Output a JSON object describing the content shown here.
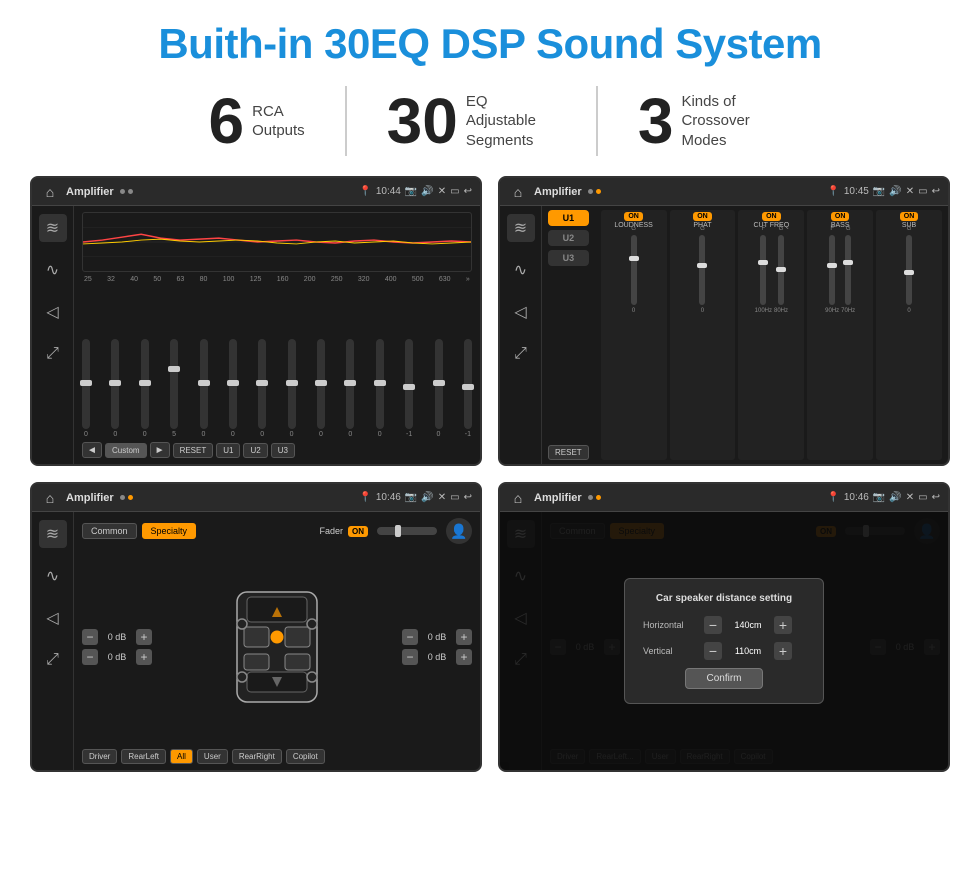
{
  "title": "Buith-in 30EQ DSP Sound System",
  "stats": [
    {
      "number": "6",
      "label": "RCA\nOutputs"
    },
    {
      "number": "30",
      "label": "EQ Adjustable\nSegments"
    },
    {
      "number": "3",
      "label": "Kinds of\nCrossover Modes"
    }
  ],
  "screens": [
    {
      "id": "eq-screen",
      "topbar": {
        "title": "Amplifier",
        "time": "10:44"
      },
      "type": "eq"
    },
    {
      "id": "crossover-screen",
      "topbar": {
        "title": "Amplifier",
        "time": "10:45"
      },
      "type": "crossover"
    },
    {
      "id": "fader-screen",
      "topbar": {
        "title": "Amplifier",
        "time": "10:46"
      },
      "type": "fader"
    },
    {
      "id": "distance-screen",
      "topbar": {
        "title": "Amplifier",
        "time": "10:46"
      },
      "type": "distance"
    }
  ],
  "eq": {
    "frequencies": [
      "25",
      "32",
      "40",
      "50",
      "63",
      "80",
      "100",
      "125",
      "160",
      "200",
      "250",
      "320",
      "400",
      "500",
      "630"
    ],
    "values": [
      "0",
      "0",
      "0",
      "5",
      "0",
      "0",
      "0",
      "0",
      "0",
      "0",
      "0",
      "-1",
      "0",
      "-1",
      "0"
    ],
    "preset": "Custom",
    "buttons": [
      "Custom",
      "RESET",
      "U1",
      "U2",
      "U3"
    ]
  },
  "crossover": {
    "channels": [
      "U1",
      "U2",
      "U3"
    ],
    "bands": [
      "LOUDNESS",
      "PHAT",
      "CUT FREQ",
      "BASS",
      "SUB"
    ],
    "resetLabel": "RESET"
  },
  "fader": {
    "tabs": [
      "Common",
      "Specialty"
    ],
    "faderLabel": "Fader",
    "onLabel": "ON",
    "channels": {
      "driver": "0 dB",
      "copilot": "0 dB",
      "rearLeft": "0 dB",
      "rearRight": "0 dB"
    },
    "bottomButtons": [
      "Driver",
      "RearLeft",
      "All",
      "User",
      "RearRight",
      "Copilot"
    ]
  },
  "distance": {
    "dialogTitle": "Car speaker distance setting",
    "horizontal": {
      "label": "Horizontal",
      "value": "140cm"
    },
    "vertical": {
      "label": "Vertical",
      "value": "110cm"
    },
    "confirmLabel": "Confirm",
    "tabs": [
      "Common",
      "Specialty"
    ],
    "channels": {
      "driver": "0 dB",
      "copilot": "0 dB"
    }
  }
}
